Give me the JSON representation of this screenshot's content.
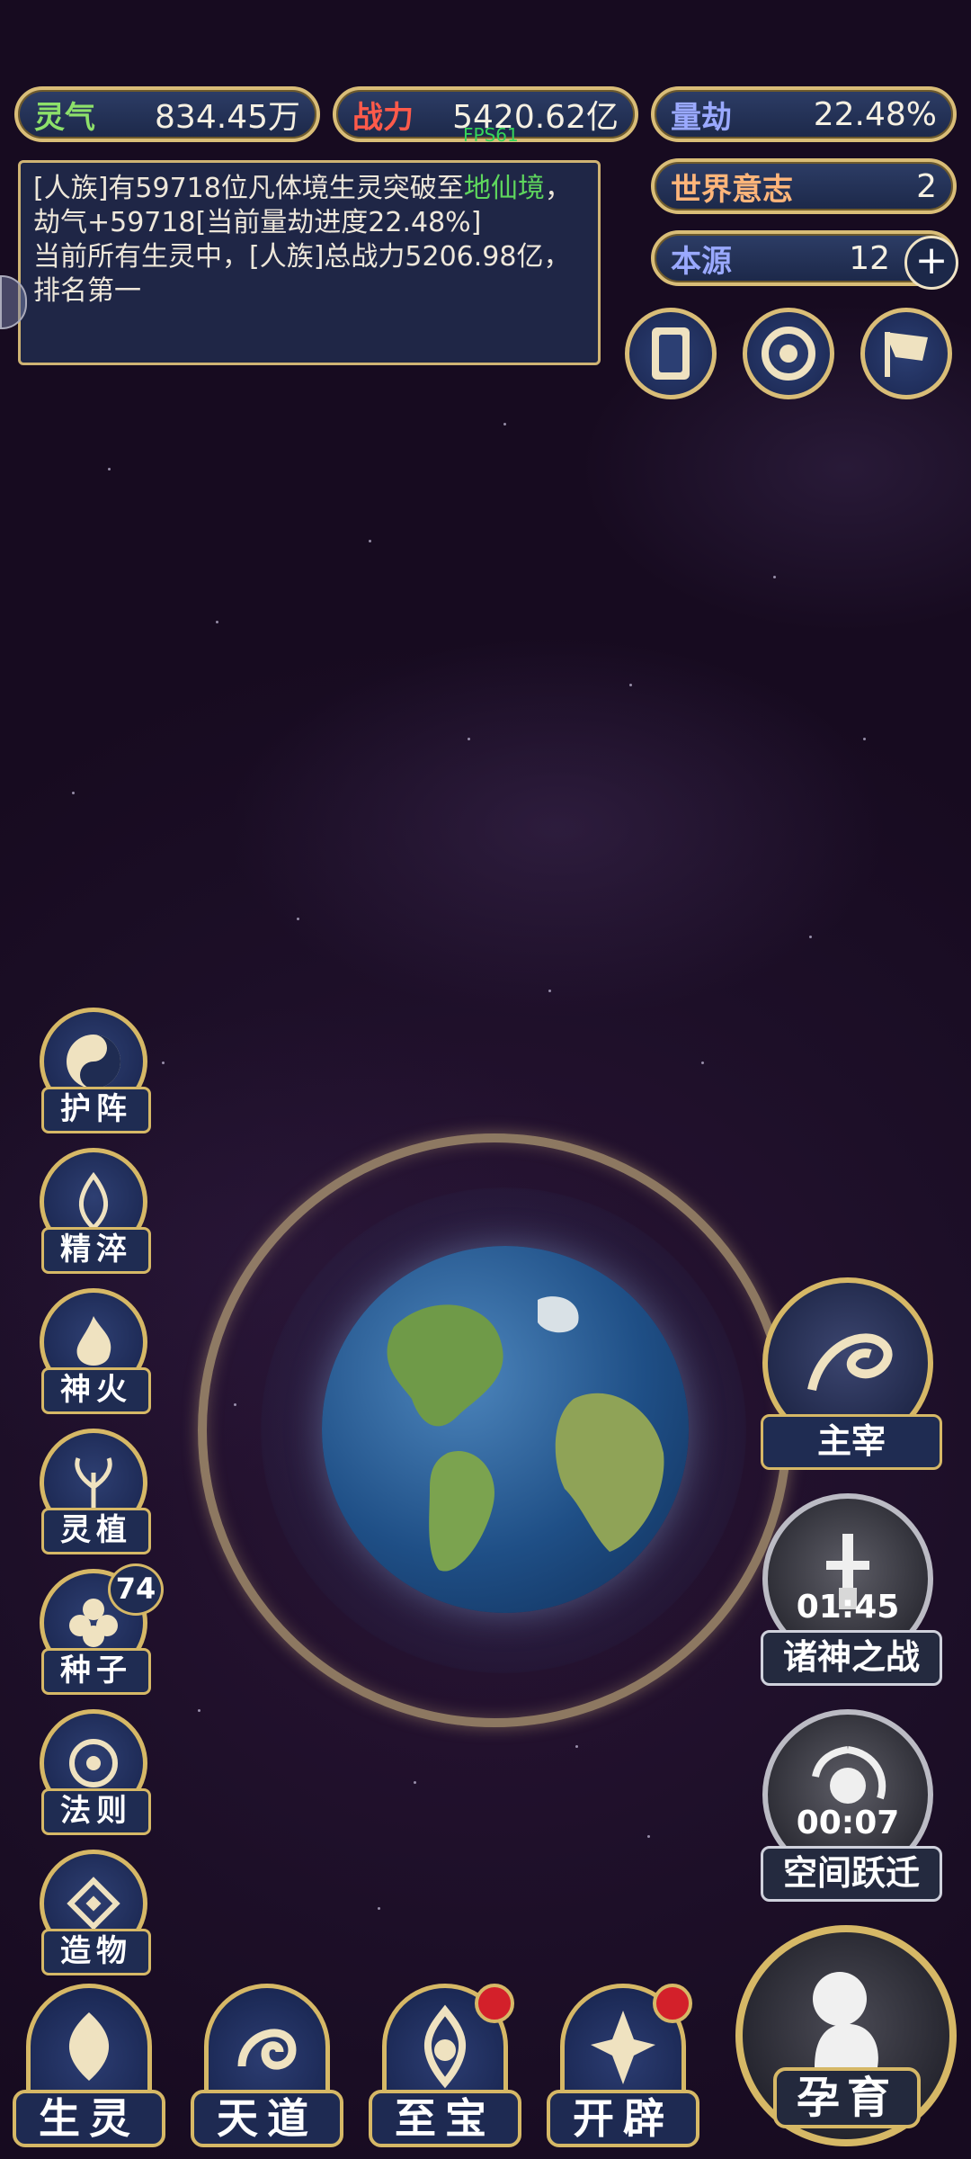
{
  "resources": {
    "lingqi": {
      "label": "灵气",
      "value": "834.45万"
    },
    "zhanli": {
      "label": "战力",
      "value": "5420.62亿"
    },
    "liangjie": {
      "label": "量劫",
      "value": "22.48%"
    },
    "shijie": {
      "label": "世界意志",
      "value": "2"
    },
    "benyuan": {
      "label": "本源",
      "value": "12"
    }
  },
  "fps": "FPS61",
  "log": {
    "line1_a": "[人族]有59718位凡体境生灵突破至",
    "line1_hl": "地仙境",
    "line1_b": "，劫气+59718[当前量劫进度22.48%]",
    "line2": "当前所有生灵中，[人族]总战力5206.98亿，排名第一"
  },
  "top_icons": [
    "card-icon",
    "portal-icon",
    "flag-icon"
  ],
  "left_menu": [
    {
      "label": "护阵",
      "icon": "taiji-icon"
    },
    {
      "label": "精淬",
      "icon": "flame-lotus-icon"
    },
    {
      "label": "神火",
      "icon": "divine-fire-icon"
    },
    {
      "label": "灵植",
      "icon": "spirit-plant-icon"
    },
    {
      "label": "种子",
      "icon": "seed-flower-icon",
      "badge": "74"
    },
    {
      "label": "法则",
      "icon": "law-icon"
    },
    {
      "label": "造物",
      "icon": "creation-icon"
    }
  ],
  "right_menu": {
    "zhuzai": {
      "label": "主宰"
    },
    "zhushen": {
      "label": "诸神之战",
      "timer": "01:45"
    },
    "kongjian": {
      "label": "空间跃迁",
      "timer": "00:07"
    }
  },
  "bottom_menu": [
    {
      "label": "生灵",
      "dot": false
    },
    {
      "label": "天道",
      "dot": false
    },
    {
      "label": "至宝",
      "dot": true
    },
    {
      "label": "开辟",
      "dot": true
    }
  ],
  "big_button": {
    "label": "孕育"
  }
}
